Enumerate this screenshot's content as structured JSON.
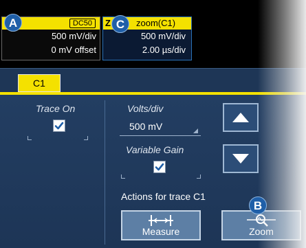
{
  "markers": {
    "a": "A",
    "b": "B",
    "c": "C"
  },
  "descriptors": {
    "c1": {
      "coupling": "DC50",
      "volts_div": "500 mV/div",
      "offset": "0 mV offset"
    },
    "zoom": {
      "letter": "Z",
      "title": "zoom(C1)",
      "volts_div": "500 mV/div",
      "time_div": "2.00 µs/div"
    }
  },
  "dialog": {
    "tab_label": "C1",
    "trace_on_label": "Trace On",
    "trace_on_checked": true,
    "volts_div_label": "Volts/div",
    "volts_div_value": "500 mV",
    "variable_gain_label": "Variable Gain",
    "variable_gain_checked": true,
    "actions_label": "Actions for trace C1",
    "measure_label": "Measure",
    "zoom_label": "Zoom",
    "icons": {
      "up": "up-arrow-icon",
      "down": "down-arrow-icon",
      "measure": "measure-icon",
      "zoom": "zoom-icon",
      "check": "check-icon"
    }
  },
  "colors": {
    "channel_yellow": "#f4e100",
    "dialog_blue": "#1e3656",
    "marker_blue": "#1f5fa8"
  }
}
